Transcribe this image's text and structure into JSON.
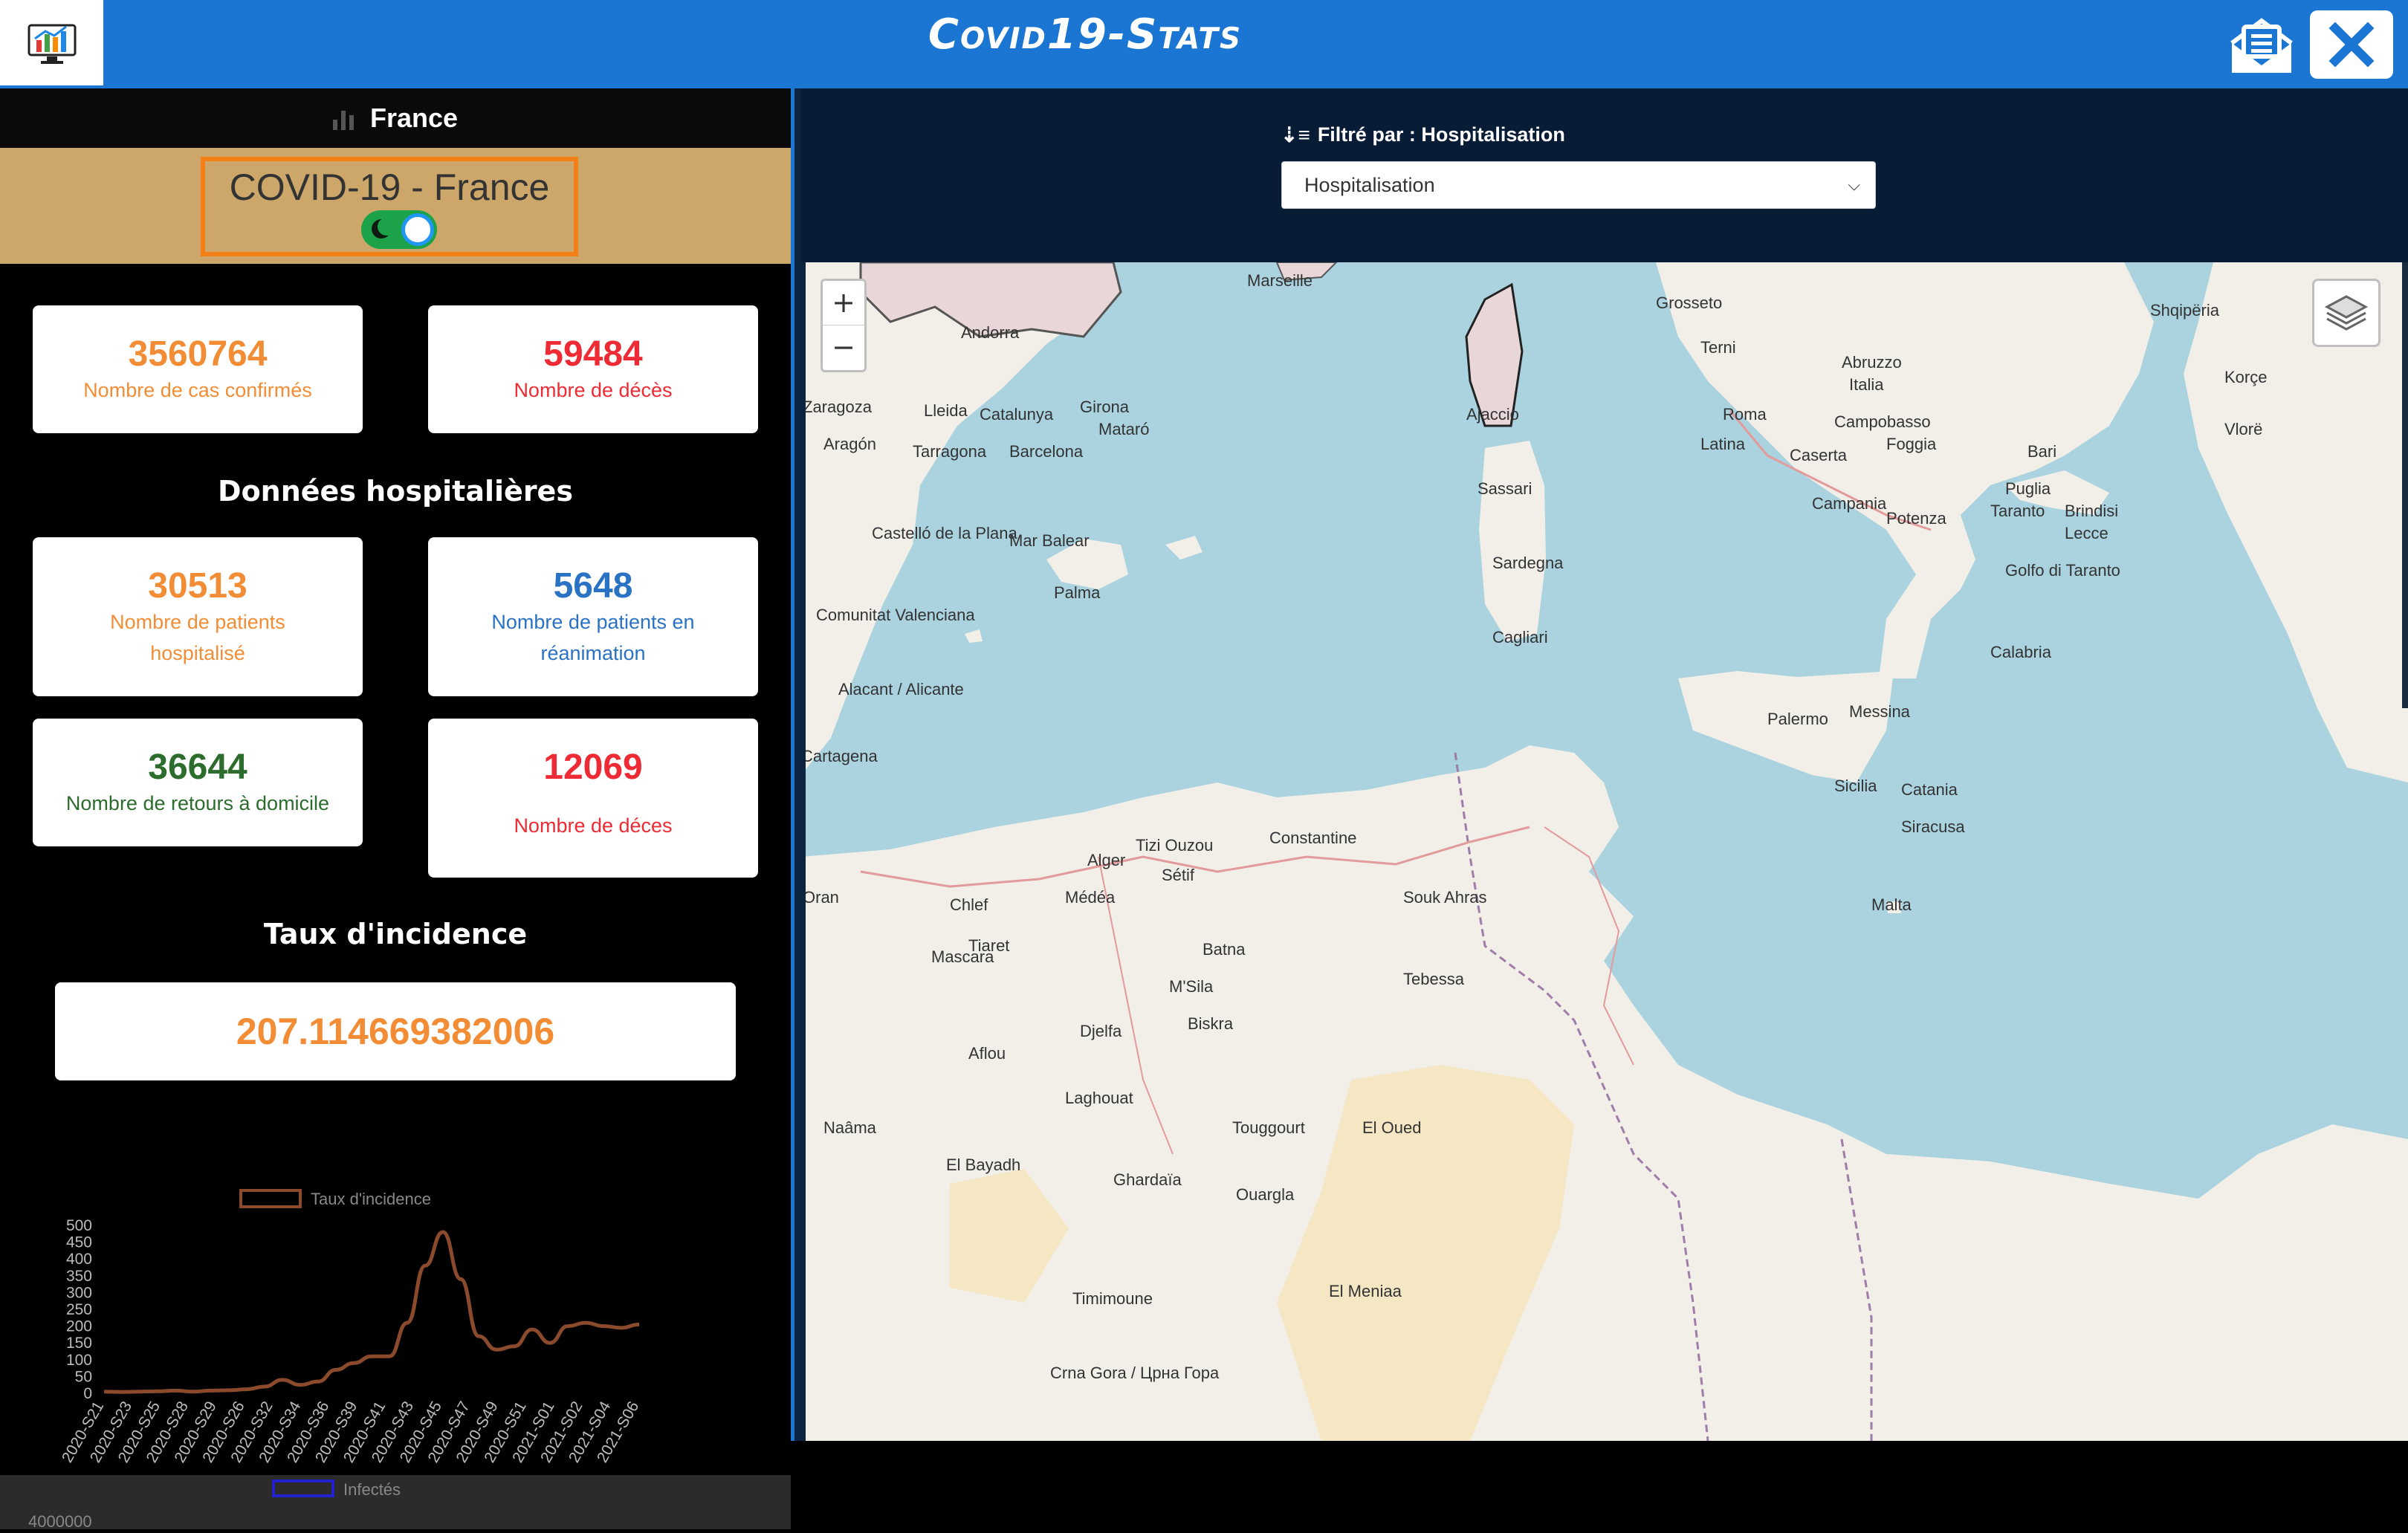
{
  "app": {
    "title": "Covid19-Stats"
  },
  "country": {
    "name": "France"
  },
  "header_card": {
    "title": "COVID-19 - France"
  },
  "stats": {
    "confirmed": {
      "value": "3560764",
      "label": "Nombre de cas confirmés"
    },
    "deaths": {
      "value": "59484",
      "label": "Nombre de décès"
    }
  },
  "hospital": {
    "title": "Données hospitalières",
    "hospitalized": {
      "value": "30513",
      "label": "Nombre de patients hospitalisé"
    },
    "icu": {
      "value": "5648",
      "label": "Nombre de patients en réanimation"
    },
    "home": {
      "value": "36644",
      "label": "Nombre de retours à domicile"
    },
    "deaths": {
      "value": "12069",
      "label": "Nombre de déces"
    }
  },
  "incidence": {
    "title": "Taux d'incidence",
    "value": "207.114669382006"
  },
  "chart_data": {
    "type": "line",
    "series": [
      {
        "name": "Taux d'incidence",
        "values": [
          5,
          4,
          5,
          6,
          8,
          5,
          8,
          9,
          12,
          20,
          40,
          25,
          35,
          70,
          90,
          110,
          110,
          210,
          380,
          480,
          340,
          170,
          130,
          140,
          190,
          150,
          200,
          210,
          200,
          195,
          205
        ]
      }
    ],
    "ylim": [
      0,
      500
    ],
    "yticks": [
      "500",
      "450",
      "400",
      "350",
      "300",
      "250",
      "200",
      "150",
      "100",
      "50",
      "0"
    ],
    "xticks": [
      "2020-S21",
      "2020-S23",
      "2020-S25",
      "2020-S28",
      "2020-S29",
      "2020-S26",
      "2020-S32",
      "2020-S34",
      "2020-S36",
      "2020-S39",
      "2020-S41",
      "2020-S43",
      "2020-S45",
      "2020-S47",
      "2020-S49",
      "2020-S51",
      "2021-S01",
      "2021-S02",
      "2021-S04",
      "2021-S06"
    ],
    "line_color": "#8b4a2b"
  },
  "second_chart": {
    "legend": "Infectés",
    "first_tick": "4000000",
    "color": "#2222cc"
  },
  "filter": {
    "label": "Filtré par : Hospitalisation",
    "selected": "Hospitalisation"
  },
  "map": {
    "zoom_in": "+",
    "zoom_out": "−",
    "labels": [
      {
        "text": "Marseille"
      },
      {
        "text": "Grosseto"
      },
      {
        "text": "Terni"
      },
      {
        "text": "Abruzzo"
      },
      {
        "text": "Italia"
      },
      {
        "text": "Roma"
      },
      {
        "text": "Campobasso"
      },
      {
        "text": "Latina"
      },
      {
        "text": "Foggia"
      },
      {
        "text": "Caserta"
      },
      {
        "text": "Bari"
      },
      {
        "text": "Puglia"
      },
      {
        "text": "Campania"
      },
      {
        "text": "Potenza"
      },
      {
        "text": "Taranto"
      },
      {
        "text": "Brindisi"
      },
      {
        "text": "Lecce"
      },
      {
        "text": "Golfo di Taranto"
      },
      {
        "text": "Calabria"
      },
      {
        "text": "Palermo"
      },
      {
        "text": "Messina"
      },
      {
        "text": "Sicilia"
      },
      {
        "text": "Catania"
      },
      {
        "text": "Siracusa"
      },
      {
        "text": "Malta"
      },
      {
        "text": "Sassari"
      },
      {
        "text": "Sardegna"
      },
      {
        "text": "Cagliari"
      },
      {
        "text": "Ajaccio"
      },
      {
        "text": "Zaragoza"
      },
      {
        "text": "Lleida"
      },
      {
        "text": "Catalunya"
      },
      {
        "text": "Girona"
      },
      {
        "text": "Mataró"
      },
      {
        "text": "Tarragona"
      },
      {
        "text": "Barcelona"
      },
      {
        "text": "Aragón"
      },
      {
        "text": "Andorra"
      },
      {
        "text": "Mar Balear"
      },
      {
        "text": "Castelló de la Plana"
      },
      {
        "text": "Palma"
      },
      {
        "text": "Comunitat Valenciana"
      },
      {
        "text": "Alacant / Alicante"
      },
      {
        "text": "Cartagena"
      },
      {
        "text": "Alger"
      },
      {
        "text": "Tizi Ouzou"
      },
      {
        "text": "Sétif"
      },
      {
        "text": "Constantine"
      },
      {
        "text": "Oran"
      },
      {
        "text": "Chlef"
      },
      {
        "text": "Médéa"
      },
      {
        "text": "Tiaret"
      },
      {
        "text": "Souk Ahras"
      },
      {
        "text": "Batna"
      },
      {
        "text": "Tebessa"
      },
      {
        "text": "M'Sila"
      },
      {
        "text": "Biskra"
      },
      {
        "text": "Mascara"
      },
      {
        "text": "Djelfa"
      },
      {
        "text": "Aflou"
      },
      {
        "text": "Laghouat"
      },
      {
        "text": "Naâma"
      },
      {
        "text": "El Bayadh"
      },
      {
        "text": "Ghardaïa"
      },
      {
        "text": "Touggourt"
      },
      {
        "text": "El Oued"
      },
      {
        "text": "Ouargla"
      },
      {
        "text": "El Meniaa"
      },
      {
        "text": "Timimoune"
      },
      {
        "text": "Crna Gora / Црна Гора"
      },
      {
        "text": "Shqipëria"
      },
      {
        "text": "Korçe"
      },
      {
        "text": "Vlorë"
      }
    ]
  }
}
